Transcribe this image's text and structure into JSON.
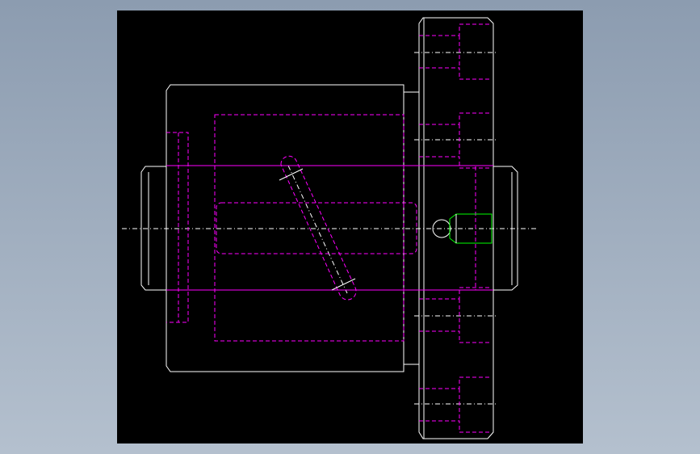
{
  "drawing": {
    "view": "cad-drawing-viewport",
    "colors": {
      "background": "#000000",
      "outline": "#ffffff",
      "hidden": "#ff00ff",
      "feature": "#00ff00",
      "centerline": "#ffffff",
      "page": "#9aa8b8"
    },
    "components": [
      "main-housing-body",
      "left-shaft-stub",
      "right-shaft-stub",
      "flange-plate",
      "angled-slot",
      "side-port",
      "hidden-bore",
      "hidden-cavity"
    ]
  }
}
